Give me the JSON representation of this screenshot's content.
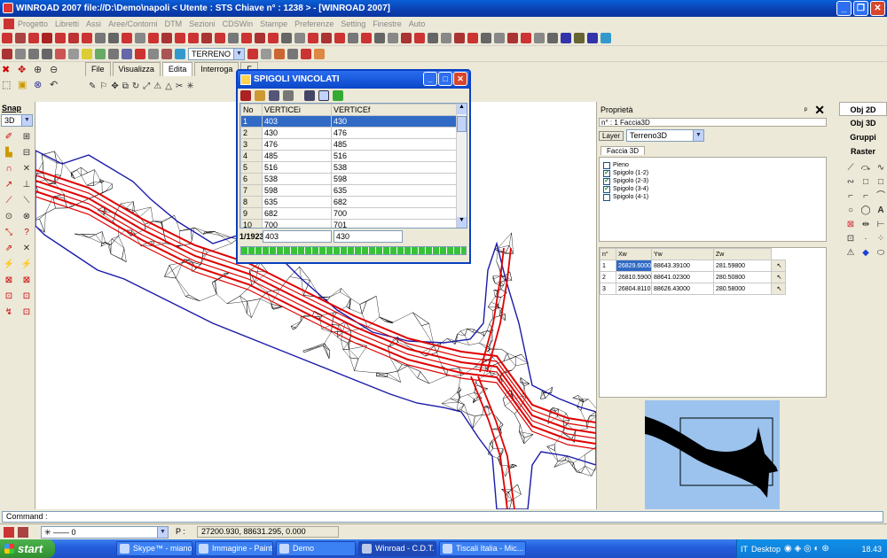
{
  "window": {
    "title": "WINROAD  2007 file://D:\\Demo\\napoli < Utente : STS Chiave n° : 1238 >  - [WINROAD  2007]"
  },
  "menu": [
    "Progetto",
    "Libretti",
    "Assi",
    "Aree/Contorni",
    "DTM",
    "Sezioni",
    "CDSWin",
    "Stampe",
    "Preferenze",
    "Setting",
    "Finestre",
    "Auto"
  ],
  "toolbar": {
    "layer_combo": "TERRENO"
  },
  "snap": {
    "label": "Snap",
    "mode": "3D"
  },
  "view_tabs": [
    "File",
    "Visualizza",
    "Edita",
    "Interroga",
    "F"
  ],
  "dialog": {
    "title": "SPIGOLI VINCOLATI",
    "columns": [
      "No",
      "VERTICEi",
      "VERTICEf"
    ],
    "rows": [
      [
        "1",
        "403",
        "430"
      ],
      [
        "2",
        "430",
        "476"
      ],
      [
        "3",
        "476",
        "485"
      ],
      [
        "4",
        "485",
        "516"
      ],
      [
        "5",
        "516",
        "538"
      ],
      [
        "6",
        "538",
        "598"
      ],
      [
        "7",
        "598",
        "635"
      ],
      [
        "8",
        "635",
        "682"
      ],
      [
        "9",
        "682",
        "700"
      ],
      [
        "10",
        "700",
        "701"
      ]
    ],
    "footer_index": "1/1923",
    "footer_vi": "403",
    "footer_vf": "430"
  },
  "properties": {
    "title": "Proprietà",
    "pin": "ᵖ",
    "item": "n° : 1 Faccia3D",
    "layer_label": "Layer",
    "layer_value": "Terreno3D",
    "tab": "Faccia 3D",
    "checks": [
      {
        "label": "Pieno",
        "checked": false
      },
      {
        "label": "Spigolo (1-2)",
        "checked": true
      },
      {
        "label": "Spigolo (2-3)",
        "checked": true
      },
      {
        "label": "Spigolo (3-4)",
        "checked": true
      },
      {
        "label": "Spigolo (4-1)",
        "checked": false
      }
    ],
    "coord_columns": [
      "n°",
      "Xw",
      "Yw",
      "Zw"
    ],
    "coords": [
      [
        "1",
        "26829.6000",
        "88643.39100",
        "281.59800"
      ],
      [
        "2",
        "26810.5900",
        "88641.02300",
        "280.50800"
      ],
      [
        "3",
        "26804.8110",
        "88626.43000",
        "280.58000"
      ]
    ]
  },
  "objects": [
    "Obj 2D",
    "Obj 3D",
    "Gruppi",
    "Raster"
  ],
  "command": {
    "label": "Command :"
  },
  "status": {
    "line_value": "0",
    "p_label": "P :",
    "coords": "27200.930, 88631.295, 0.000"
  },
  "taskbar": {
    "start": "start",
    "tasks": [
      "Skype™ - miano...",
      "Immagine - Paint",
      "Demo",
      "Winroad - C.D.T.",
      "Tiscali Italia - Mic..."
    ],
    "lang": "IT",
    "desktop": "Desktop",
    "clock": "18.43"
  },
  "colors": {
    "mesh_line": "#000000",
    "constraint_line": "#e00000",
    "boundary_line": "#1a1aa8",
    "selection": "#316ac5"
  }
}
